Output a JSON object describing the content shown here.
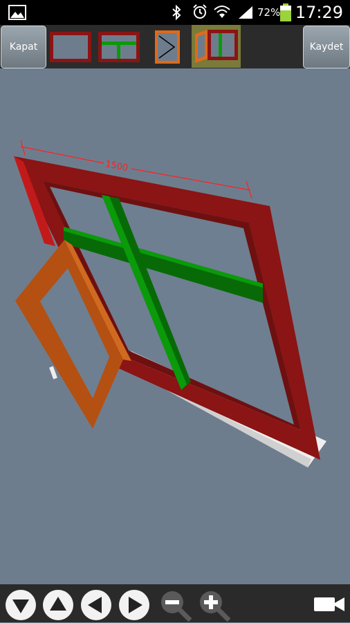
{
  "status_bar": {
    "battery_percent": "72%",
    "time": "17:29",
    "icons": [
      "gallery-icon",
      "bluetooth-icon",
      "alarm-icon",
      "wifi-icon",
      "signal-icon",
      "battery-icon"
    ]
  },
  "toolbar": {
    "close_label": "Kapat",
    "save_label": "Kaydet",
    "tools": [
      "frame-tool-icon",
      "mullion-frame-tool-icon",
      "sash-tool-icon",
      "open-sash-tool-icon"
    ],
    "selected_tool": "open-sash-tool-icon"
  },
  "scene": {
    "dimension_label": "1500",
    "colors": {
      "frame": "#8b1414",
      "mullion": "#0a7a0a",
      "sash": "#b45012",
      "glass": "#6e7f91",
      "sill": "#eeeeee"
    }
  },
  "bottom_bar": {
    "buttons": [
      "arrow-down-icon",
      "arrow-up-icon",
      "arrow-left-icon",
      "arrow-right-icon",
      "zoom-out-icon",
      "zoom-in-icon",
      "camera-icon"
    ]
  }
}
